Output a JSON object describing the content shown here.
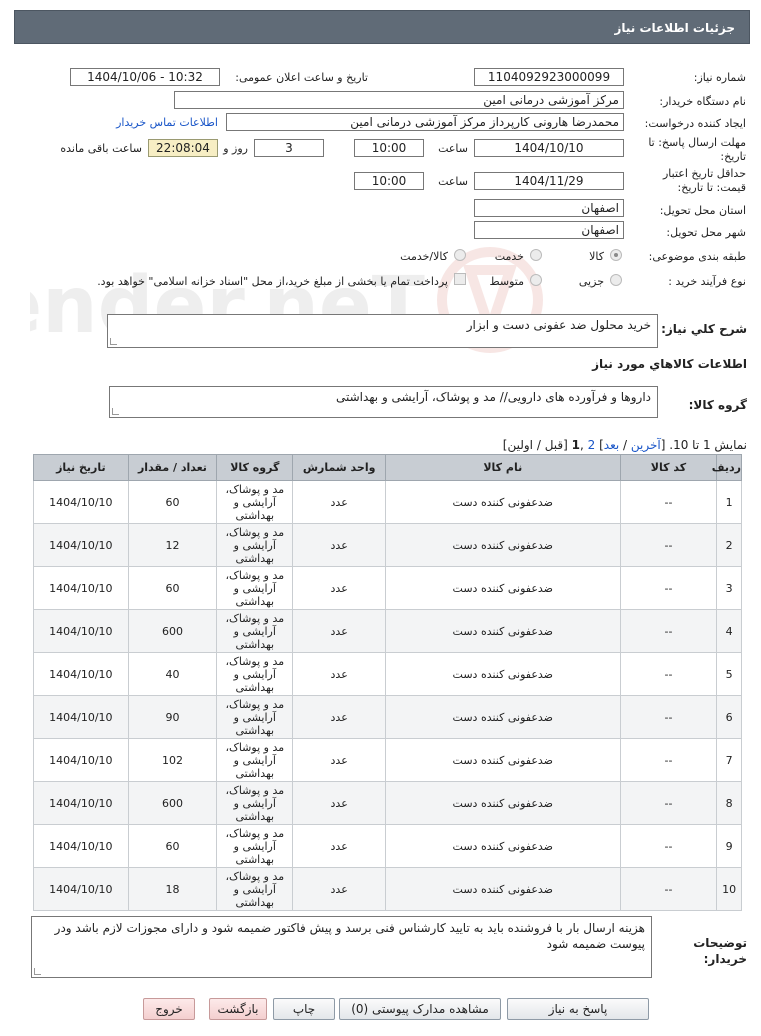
{
  "header": {
    "title": "جزئیات اطلاعات نیاز"
  },
  "form": {
    "need_number_label": "شماره نیاز:",
    "need_number": "1104092923000099",
    "announce_label": "تاریخ و ساعت اعلان عمومی:",
    "announce_value": "1404/10/06 - 10:32",
    "buyer_org_label": "نام دستگاه خریدار:",
    "buyer_org": "مرکز آموزشی درمانی امین",
    "requester_label": "ایجاد کننده درخواست:",
    "requester": "محمدرضا هارونی کارپرداز مرکز آموزشی درمانی امین",
    "contact_link": "اطلاعات تماس خریدار",
    "deadline_label_1": "مهلت ارسال پاسخ: تا",
    "deadline_label_2": "تاریخ:",
    "deadline_date": "1404/10/10",
    "time_label": "ساعت",
    "deadline_time": "10:00",
    "days_value": "3",
    "days_label": "روز و",
    "remaining_time": "22:08:04",
    "remaining_label": "ساعت باقی مانده",
    "validity_label_1": "حداقل تاریخ اعتبار",
    "validity_label_2": "قیمت: تا تاریخ:",
    "validity_date": "1404/11/29",
    "validity_time": "10:00",
    "province_label": "استان محل تحویل:",
    "province": "اصفهان",
    "city_label": "شهر محل تحویل:",
    "city": "اصفهان",
    "category_label": "طبقه بندی موضوعی:",
    "category_options": [
      "کالا",
      "خدمت",
      "کالا/خدمت"
    ],
    "category_selected": "کالا",
    "process_label": "نوع فرآیند خرید :",
    "process_options": [
      "جزیی",
      "متوسط"
    ],
    "payment_note": "پرداخت تمام یا بخشی از مبلغ خرید،از محل \"اسناد خزانه اسلامی\" خواهد بود."
  },
  "description": {
    "label": "شرح کلي نياز:",
    "value": "خرید محلول ضد عفونی دست و ابزار"
  },
  "goods_info": {
    "heading": "اطلاعات کالاهاي مورد نياز",
    "group_label": "گروه کالا:",
    "group_value": "داروها و فرآورده های دارویی// مد و پوشاک، آرایشی و بهداشتی"
  },
  "paging": {
    "text_prefix": "نمایش 1 تا 10. [",
    "last": "آخرین",
    "sep1": " / ",
    "next": "بعد",
    "mid": "] ",
    "page2": "2",
    "comma": " ,",
    "page1": "1",
    "suffix": " [قبل / اولین]"
  },
  "table": {
    "headers": [
      "ردیف",
      "کد کالا",
      "نام کالا",
      "واحد شمارش",
      "گروه کالا",
      "تعداد / مقدار",
      "تاریخ نیاز"
    ],
    "rows": [
      [
        "1",
        "--",
        "ضدعفونی کننده دست",
        "عدد",
        "مد و پوشاک، آرایشی و بهداشتی",
        "60",
        "1404/10/10"
      ],
      [
        "2",
        "--",
        "ضدعفونی کننده دست",
        "عدد",
        "مد و پوشاک، آرایشی و بهداشتی",
        "12",
        "1404/10/10"
      ],
      [
        "3",
        "--",
        "ضدعفونی کننده دست",
        "عدد",
        "مد و پوشاک، آرایشی و بهداشتی",
        "60",
        "1404/10/10"
      ],
      [
        "4",
        "--",
        "ضدعفونی کننده دست",
        "عدد",
        "مد و پوشاک، آرایشی و بهداشتی",
        "600",
        "1404/10/10"
      ],
      [
        "5",
        "--",
        "ضدعفونی کننده دست",
        "عدد",
        "مد و پوشاک، آرایشی و بهداشتی",
        "40",
        "1404/10/10"
      ],
      [
        "6",
        "--",
        "ضدعفونی کننده دست",
        "عدد",
        "مد و پوشاک، آرایشی و بهداشتی",
        "90",
        "1404/10/10"
      ],
      [
        "7",
        "--",
        "ضدعفونی کننده دست",
        "عدد",
        "مد و پوشاک، آرایشی و بهداشتی",
        "102",
        "1404/10/10"
      ],
      [
        "8",
        "--",
        "ضدعفونی کننده دست",
        "عدد",
        "مد و پوشاک، آرایشی و بهداشتی",
        "600",
        "1404/10/10"
      ],
      [
        "9",
        "--",
        "ضدعفونی کننده دست",
        "عدد",
        "مد و پوشاک، آرایشی و بهداشتی",
        "60",
        "1404/10/10"
      ],
      [
        "10",
        "--",
        "ضدعفونی کننده دست",
        "عدد",
        "مد و پوشاک، آرایشی و بهداشتی",
        "18",
        "1404/10/10"
      ]
    ]
  },
  "notes": {
    "label": "توضیحات خریدار:",
    "value": "هزینه ارسال بار با فروشنده باید به تایید کارشناس فنی برسد و پیش فاکتور ضمیمه شود و دارای مجوزات لازم باشد ودر پیوست ضمیمه شود"
  },
  "buttons": {
    "reply": "پاسخ به نیاز",
    "attachments": "مشاهده مدارک پیوستی (0)",
    "print": "چاپ",
    "back": "بازگشت",
    "exit": "خروج"
  },
  "watermark": {
    "text": "AriaTender.neT"
  },
  "colors": {
    "header_bg": "#606b77",
    "link": "#1a56c8",
    "table_header": "#c8cdd3",
    "remaining_bg": "#f7eec4"
  }
}
